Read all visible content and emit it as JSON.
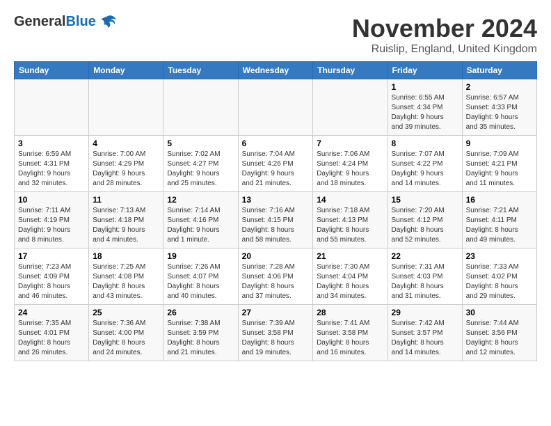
{
  "header": {
    "logo_general": "General",
    "logo_blue": "Blue",
    "month_title": "November 2024",
    "subtitle": "Ruislip, England, United Kingdom"
  },
  "weekdays": [
    "Sunday",
    "Monday",
    "Tuesday",
    "Wednesday",
    "Thursday",
    "Friday",
    "Saturday"
  ],
  "weeks": [
    [
      {
        "day": "",
        "info": ""
      },
      {
        "day": "",
        "info": ""
      },
      {
        "day": "",
        "info": ""
      },
      {
        "day": "",
        "info": ""
      },
      {
        "day": "",
        "info": ""
      },
      {
        "day": "1",
        "info": "Sunrise: 6:55 AM\nSunset: 4:34 PM\nDaylight: 9 hours\nand 39 minutes."
      },
      {
        "day": "2",
        "info": "Sunrise: 6:57 AM\nSunset: 4:33 PM\nDaylight: 9 hours\nand 35 minutes."
      }
    ],
    [
      {
        "day": "3",
        "info": "Sunrise: 6:59 AM\nSunset: 4:31 PM\nDaylight: 9 hours\nand 32 minutes."
      },
      {
        "day": "4",
        "info": "Sunrise: 7:00 AM\nSunset: 4:29 PM\nDaylight: 9 hours\nand 28 minutes."
      },
      {
        "day": "5",
        "info": "Sunrise: 7:02 AM\nSunset: 4:27 PM\nDaylight: 9 hours\nand 25 minutes."
      },
      {
        "day": "6",
        "info": "Sunrise: 7:04 AM\nSunset: 4:26 PM\nDaylight: 9 hours\nand 21 minutes."
      },
      {
        "day": "7",
        "info": "Sunrise: 7:06 AM\nSunset: 4:24 PM\nDaylight: 9 hours\nand 18 minutes."
      },
      {
        "day": "8",
        "info": "Sunrise: 7:07 AM\nSunset: 4:22 PM\nDaylight: 9 hours\nand 14 minutes."
      },
      {
        "day": "9",
        "info": "Sunrise: 7:09 AM\nSunset: 4:21 PM\nDaylight: 9 hours\nand 11 minutes."
      }
    ],
    [
      {
        "day": "10",
        "info": "Sunrise: 7:11 AM\nSunset: 4:19 PM\nDaylight: 9 hours\nand 8 minutes."
      },
      {
        "day": "11",
        "info": "Sunrise: 7:13 AM\nSunset: 4:18 PM\nDaylight: 9 hours\nand 4 minutes."
      },
      {
        "day": "12",
        "info": "Sunrise: 7:14 AM\nSunset: 4:16 PM\nDaylight: 9 hours\nand 1 minute."
      },
      {
        "day": "13",
        "info": "Sunrise: 7:16 AM\nSunset: 4:15 PM\nDaylight: 8 hours\nand 58 minutes."
      },
      {
        "day": "14",
        "info": "Sunrise: 7:18 AM\nSunset: 4:13 PM\nDaylight: 8 hours\nand 55 minutes."
      },
      {
        "day": "15",
        "info": "Sunrise: 7:20 AM\nSunset: 4:12 PM\nDaylight: 8 hours\nand 52 minutes."
      },
      {
        "day": "16",
        "info": "Sunrise: 7:21 AM\nSunset: 4:11 PM\nDaylight: 8 hours\nand 49 minutes."
      }
    ],
    [
      {
        "day": "17",
        "info": "Sunrise: 7:23 AM\nSunset: 4:09 PM\nDaylight: 8 hours\nand 46 minutes."
      },
      {
        "day": "18",
        "info": "Sunrise: 7:25 AM\nSunset: 4:08 PM\nDaylight: 8 hours\nand 43 minutes."
      },
      {
        "day": "19",
        "info": "Sunrise: 7:26 AM\nSunset: 4:07 PM\nDaylight: 8 hours\nand 40 minutes."
      },
      {
        "day": "20",
        "info": "Sunrise: 7:28 AM\nSunset: 4:06 PM\nDaylight: 8 hours\nand 37 minutes."
      },
      {
        "day": "21",
        "info": "Sunrise: 7:30 AM\nSunset: 4:04 PM\nDaylight: 8 hours\nand 34 minutes."
      },
      {
        "day": "22",
        "info": "Sunrise: 7:31 AM\nSunset: 4:03 PM\nDaylight: 8 hours\nand 31 minutes."
      },
      {
        "day": "23",
        "info": "Sunrise: 7:33 AM\nSunset: 4:02 PM\nDaylight: 8 hours\nand 29 minutes."
      }
    ],
    [
      {
        "day": "24",
        "info": "Sunrise: 7:35 AM\nSunset: 4:01 PM\nDaylight: 8 hours\nand 26 minutes."
      },
      {
        "day": "25",
        "info": "Sunrise: 7:36 AM\nSunset: 4:00 PM\nDaylight: 8 hours\nand 24 minutes."
      },
      {
        "day": "26",
        "info": "Sunrise: 7:38 AM\nSunset: 3:59 PM\nDaylight: 8 hours\nand 21 minutes."
      },
      {
        "day": "27",
        "info": "Sunrise: 7:39 AM\nSunset: 3:58 PM\nDaylight: 8 hours\nand 19 minutes."
      },
      {
        "day": "28",
        "info": "Sunrise: 7:41 AM\nSunset: 3:58 PM\nDaylight: 8 hours\nand 16 minutes."
      },
      {
        "day": "29",
        "info": "Sunrise: 7:42 AM\nSunset: 3:57 PM\nDaylight: 8 hours\nand 14 minutes."
      },
      {
        "day": "30",
        "info": "Sunrise: 7:44 AM\nSunset: 3:56 PM\nDaylight: 8 hours\nand 12 minutes."
      }
    ]
  ]
}
